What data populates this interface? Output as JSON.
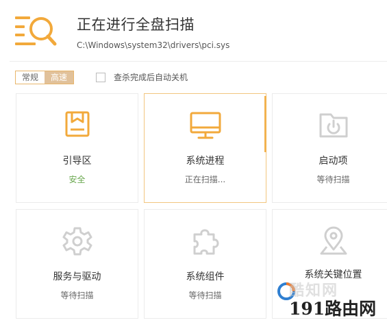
{
  "header": {
    "title": "正在进行全盘扫描",
    "path": "C:\\Windows\\system32\\drivers\\pci.sys",
    "accent_color": "#f2a93b"
  },
  "mode": {
    "options": [
      "常规",
      "高速"
    ],
    "selected": "高速"
  },
  "auto_shutdown": {
    "label": "查杀完成后自动关机",
    "checked": false
  },
  "cards": [
    {
      "label": "引导区",
      "status": "安全",
      "icon": "book-icon",
      "state": "done"
    },
    {
      "label": "系统进程",
      "status": "正在扫描...",
      "icon": "monitor-icon",
      "state": "scanning"
    },
    {
      "label": "启动项",
      "status": "等待扫描",
      "icon": "power-folder-icon",
      "state": "waiting"
    },
    {
      "label": "服务与驱动",
      "status": "等待扫描",
      "icon": "gear-icon",
      "state": "waiting"
    },
    {
      "label": "系统组件",
      "status": "等待扫描",
      "icon": "puzzle-icon",
      "state": "waiting"
    },
    {
      "label": "系统关键位置",
      "status": "",
      "icon": "location-pin-icon",
      "state": "waiting"
    }
  ],
  "watermark": {
    "brand_text": "酷知网",
    "site_text": "191路由网"
  }
}
